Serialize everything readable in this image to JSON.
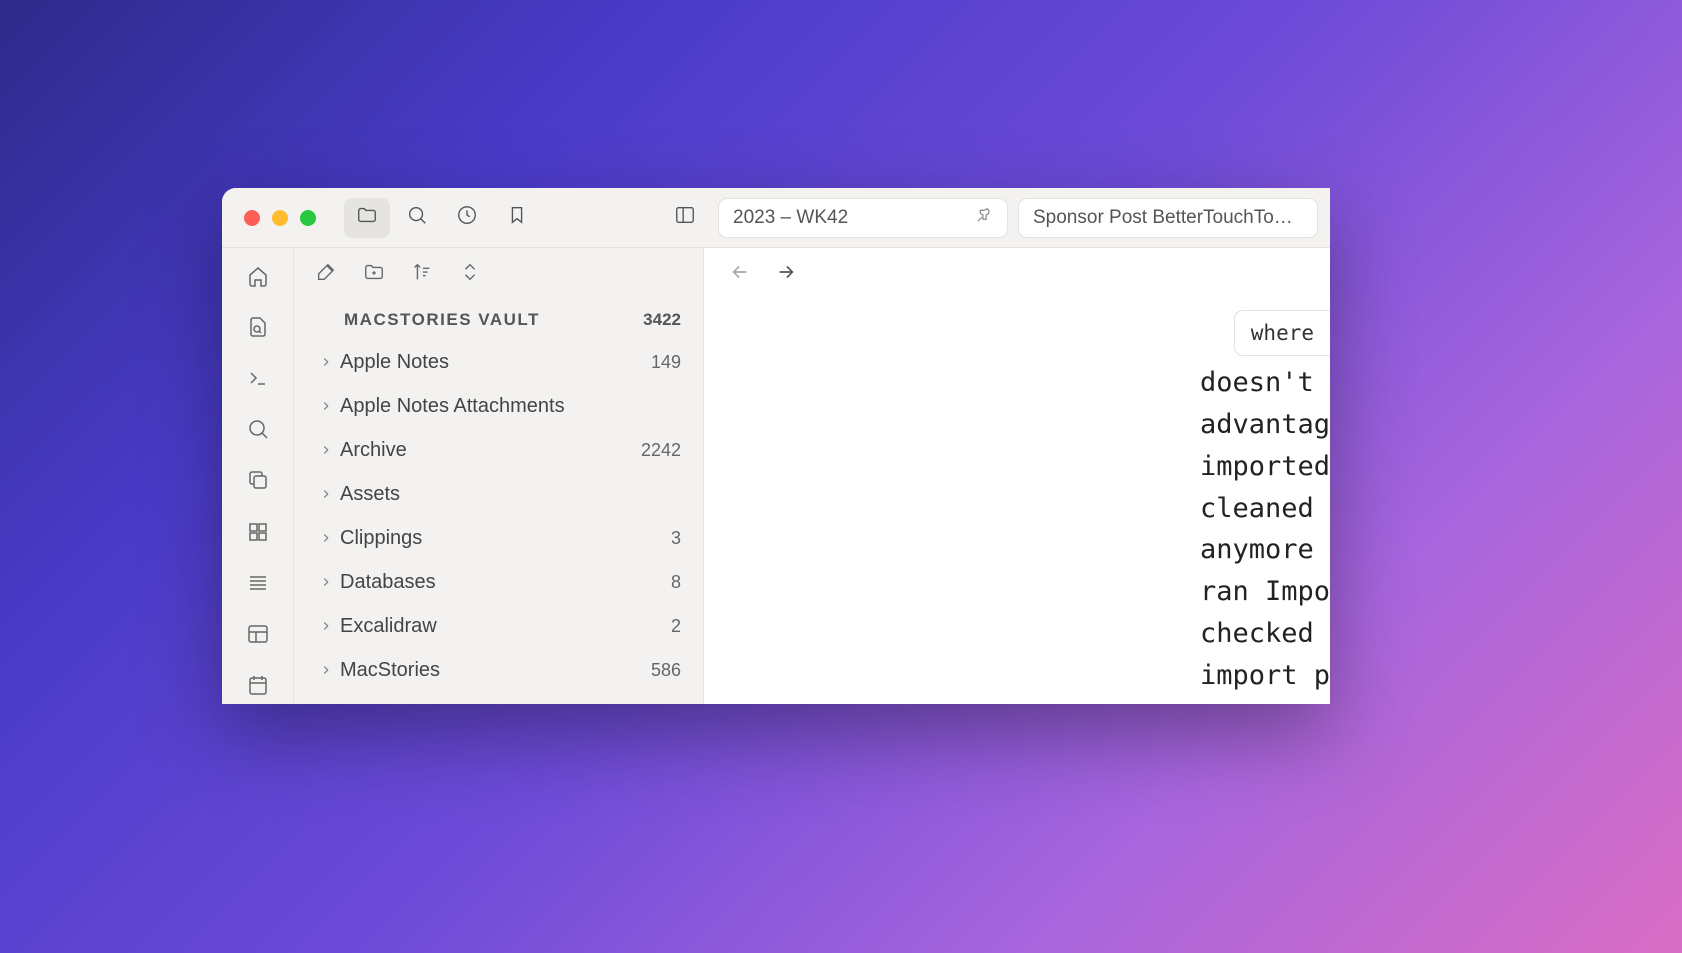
{
  "tabs": {
    "primary": "2023 – WK42",
    "secondary": "Sponsor Post BetterTouchTo…"
  },
  "vault": {
    "title": "MACSTORIES VAULT",
    "count": "3422"
  },
  "folders": [
    {
      "name": "Apple Notes",
      "count": "149"
    },
    {
      "name": "Apple Notes Attachments",
      "count": ""
    },
    {
      "name": "Archive",
      "count": "2242"
    },
    {
      "name": "Assets",
      "count": ""
    },
    {
      "name": "Clippings",
      "count": "3"
    },
    {
      "name": "Databases",
      "count": "8"
    },
    {
      "name": "Excalidraw",
      "count": "2"
    },
    {
      "name": "MacStories",
      "count": "586"
    }
  ],
  "search": {
    "query": "where"
  },
  "doc": {
    "lines": [
      "doesn't",
      "advantag",
      "imported",
      "cleaned ",
      "anymore ",
      "ran Impo",
      "checked ",
      "import p"
    ]
  }
}
